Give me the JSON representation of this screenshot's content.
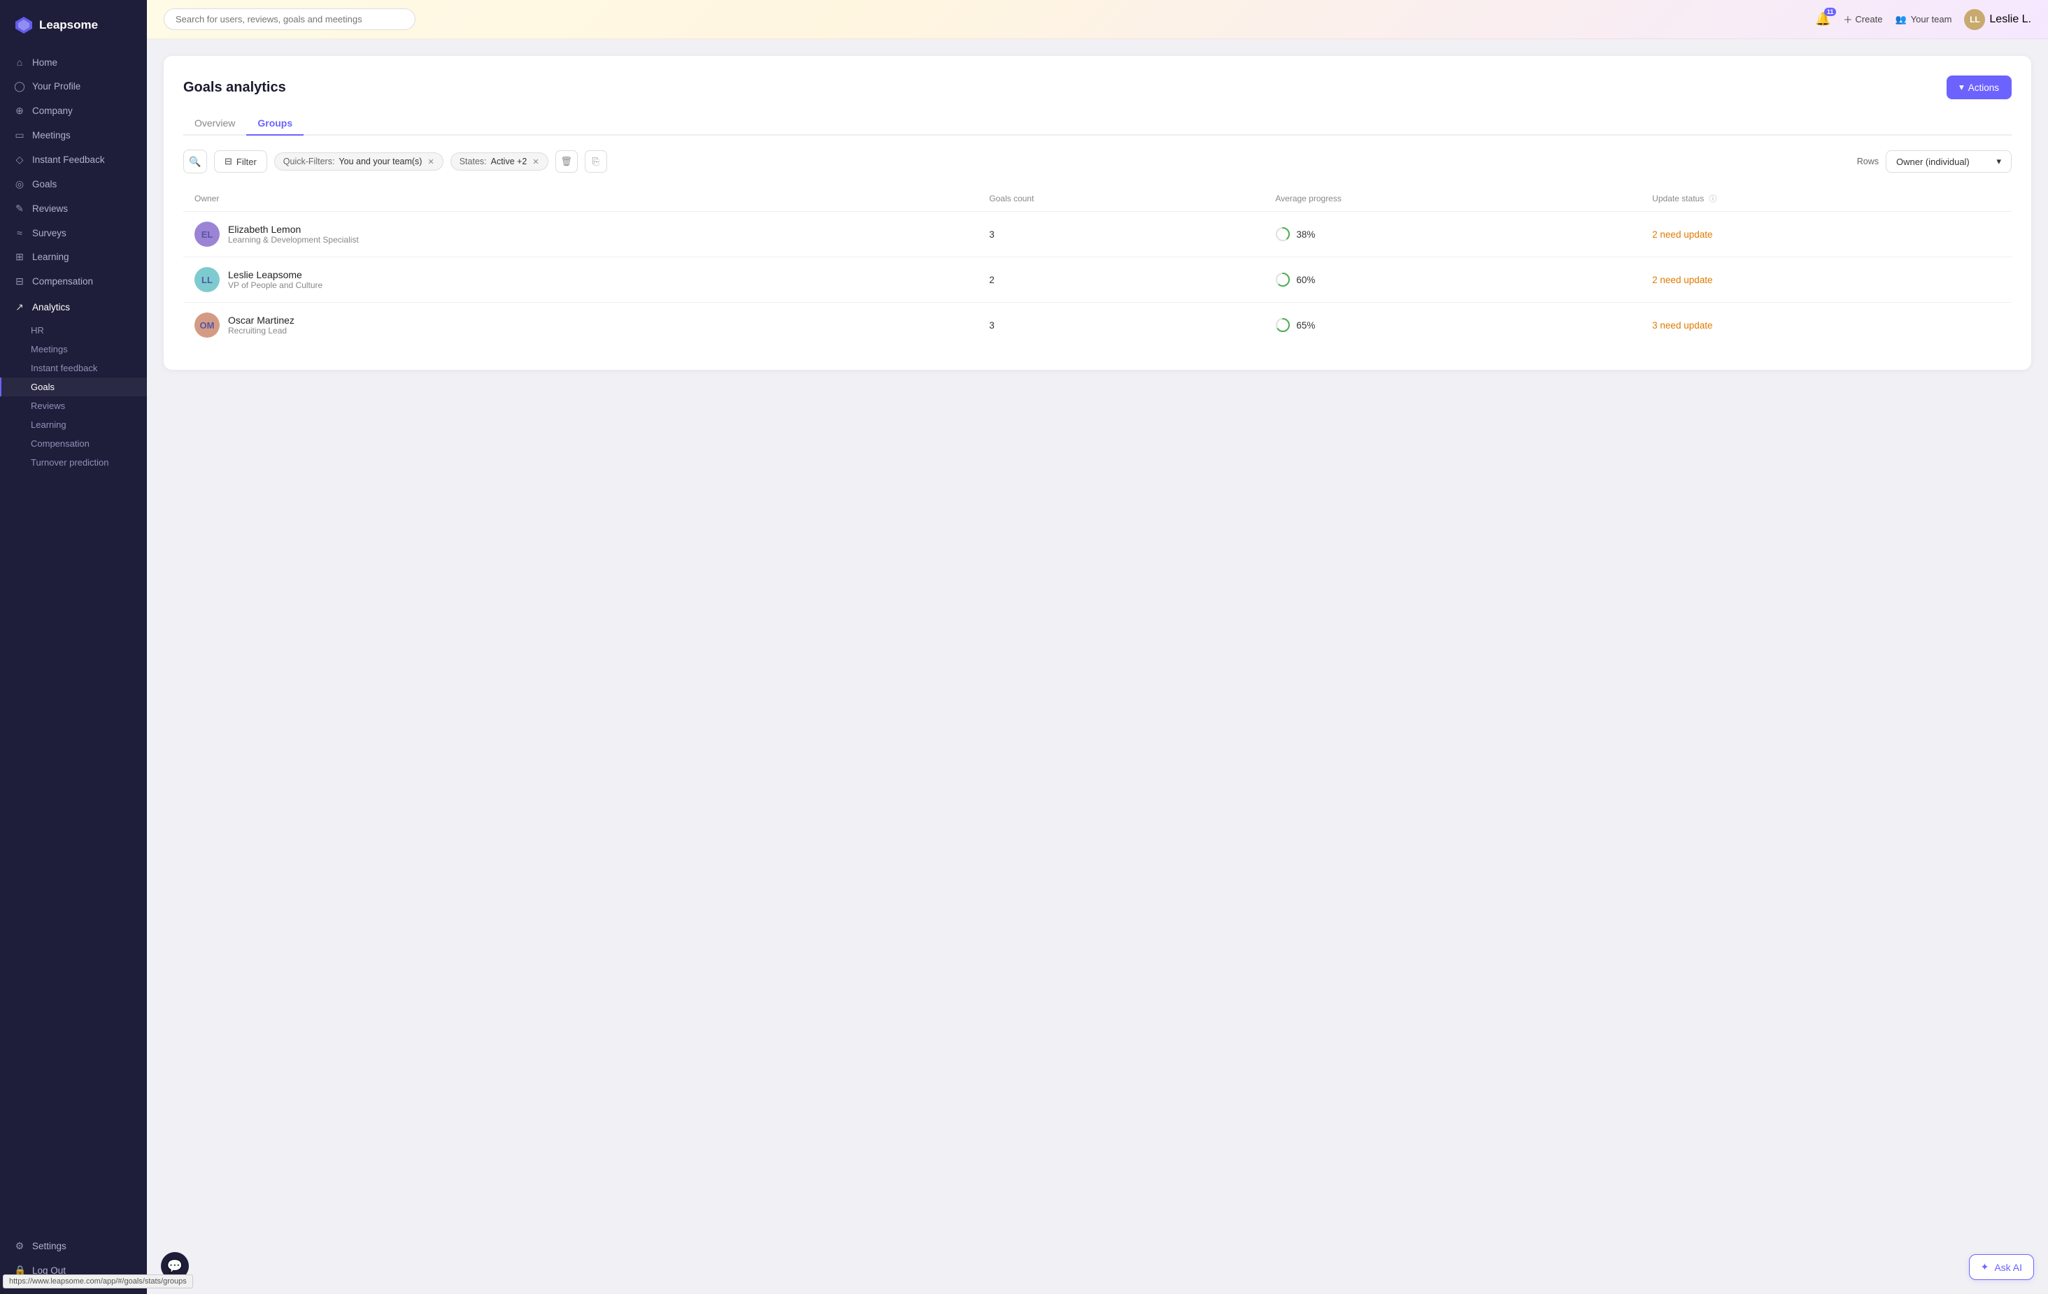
{
  "app": {
    "name": "Leapsome"
  },
  "topbar": {
    "search_placeholder": "Search for users, reviews, goals and meetings",
    "notification_count": "11",
    "create_label": "Create",
    "your_team_label": "Your team",
    "user_label": "Leslie L."
  },
  "sidebar": {
    "nav_items": [
      {
        "id": "home",
        "label": "Home",
        "icon": "⌂"
      },
      {
        "id": "your-profile",
        "label": "Your Profile",
        "icon": "○"
      },
      {
        "id": "company",
        "label": "Company",
        "icon": "⊕"
      },
      {
        "id": "meetings",
        "label": "Meetings",
        "icon": "□"
      },
      {
        "id": "instant-feedback",
        "label": "Instant Feedback",
        "icon": "◇"
      },
      {
        "id": "goals",
        "label": "Goals",
        "icon": "◎"
      },
      {
        "id": "reviews",
        "label": "Reviews",
        "icon": "✎"
      },
      {
        "id": "surveys",
        "label": "Surveys",
        "icon": "≈"
      },
      {
        "id": "learning",
        "label": "Learning",
        "icon": "⊞"
      },
      {
        "id": "compensation",
        "label": "Compensation",
        "icon": "⊟"
      },
      {
        "id": "analytics",
        "label": "Analytics",
        "icon": "↗",
        "active": true
      }
    ],
    "analytics_sub": [
      {
        "id": "hr",
        "label": "HR"
      },
      {
        "id": "meetings",
        "label": "Meetings"
      },
      {
        "id": "instant-feedback",
        "label": "Instant feedback"
      },
      {
        "id": "goals",
        "label": "Goals",
        "active": true
      },
      {
        "id": "reviews",
        "label": "Reviews"
      },
      {
        "id": "learning",
        "label": "Learning"
      },
      {
        "id": "compensation",
        "label": "Compensation"
      },
      {
        "id": "turnover-prediction",
        "label": "Turnover prediction"
      }
    ],
    "bottom_items": [
      {
        "id": "settings",
        "label": "Settings",
        "icon": "⚙"
      },
      {
        "id": "log-out",
        "label": "Log Out",
        "icon": "🔒"
      }
    ]
  },
  "page": {
    "title": "Goals analytics",
    "actions_label": "Actions",
    "tabs": [
      {
        "id": "overview",
        "label": "Overview",
        "active": false
      },
      {
        "id": "groups",
        "label": "Groups",
        "active": true
      }
    ],
    "toolbar": {
      "filter_label": "Filter",
      "quick_filter_label": "Quick-Filters:",
      "quick_filter_value": "You and your team(s)",
      "states_label": "States:",
      "states_value": "Active +2",
      "rows_label": "Rows",
      "rows_value": "Owner (individual)"
    },
    "table": {
      "headers": [
        {
          "id": "owner",
          "label": "Owner"
        },
        {
          "id": "goals-count",
          "label": "Goals count"
        },
        {
          "id": "avg-progress",
          "label": "Average progress"
        },
        {
          "id": "update-status",
          "label": "Update status"
        }
      ],
      "rows": [
        {
          "id": 1,
          "owner_name": "Elizabeth Lemon",
          "owner_role": "Learning & Development Specialist",
          "owner_initials": "EL",
          "goals_count": "3",
          "avg_progress": "38%",
          "progress_value": 38,
          "update_status": "2 need update"
        },
        {
          "id": 2,
          "owner_name": "Leslie Leapsome",
          "owner_role": "VP of People and Culture",
          "owner_initials": "LL",
          "goals_count": "2",
          "avg_progress": "60%",
          "progress_value": 60,
          "update_status": "2 need update"
        },
        {
          "id": 3,
          "owner_name": "Oscar Martinez",
          "owner_role": "Recruiting Lead",
          "owner_initials": "OM",
          "goals_count": "3",
          "avg_progress": "65%",
          "progress_value": 65,
          "update_status": "3 need update"
        }
      ]
    }
  },
  "footer": {
    "url": "https://www.leapsome.com/app/#/goals/stats/groups",
    "ask_ai_label": "Ask AI"
  },
  "colors": {
    "accent": "#6c63ff",
    "update_status": "#e07b00",
    "progress_green": "#4caf50"
  }
}
